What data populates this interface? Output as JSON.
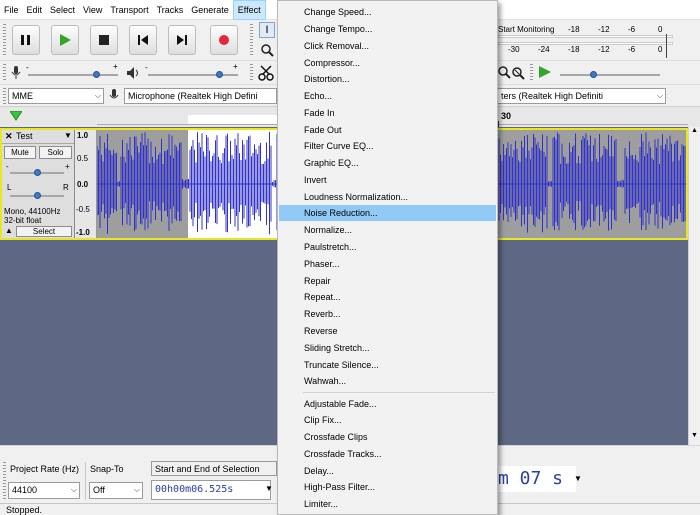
{
  "menubar": {
    "items": [
      "File",
      "Edit",
      "Select",
      "View",
      "Transport",
      "Tracks",
      "Generate",
      "Effect"
    ],
    "active_index": 7
  },
  "meter": {
    "start_monitoring": "Start Monitoring",
    "rec_ticks": [
      "-18",
      "-12",
      "-6",
      "0"
    ],
    "play_ticks": [
      "-30",
      "-24",
      "-18",
      "-12",
      "-6",
      "0"
    ]
  },
  "device": {
    "host": "MME",
    "input": "Microphone (Realtek High Defini",
    "output": "ters (Realtek High Definiti"
  },
  "timeline": {
    "tick_30": "30"
  },
  "track": {
    "name": "Test",
    "mute": "Mute",
    "solo": "Solo",
    "gain_min": "-",
    "gain_max": "+",
    "pan_left": "L",
    "pan_right": "R",
    "info_line1": "Mono, 44100Hz",
    "info_line2": "32-bit float",
    "select": "Select",
    "ruler": [
      "1.0",
      "0.5",
      "0.0",
      "-0.5",
      "-1.0"
    ]
  },
  "bottom": {
    "project_rate_label": "Project Rate (Hz)",
    "project_rate_value": "44100",
    "snap_label": "Snap-To",
    "snap_value": "Off",
    "selection_label": "Start and End of Selection",
    "selection_value": "00h00m06.525s",
    "audio_pos": "m 07 s"
  },
  "status": "Stopped.",
  "effect_menu": {
    "group1": [
      "Change Speed...",
      "Change Tempo...",
      "Click Removal...",
      "Compressor...",
      "Distortion...",
      "Echo...",
      "Fade In",
      "Fade Out",
      "Filter Curve EQ...",
      "Graphic EQ...",
      "Invert",
      "Loudness Normalization...",
      "Noise Reduction...",
      "Normalize...",
      "Paulstretch...",
      "Phaser...",
      "Repair",
      "Repeat...",
      "Reverb...",
      "Reverse",
      "Sliding Stretch...",
      "Truncate Silence...",
      "Wahwah..."
    ],
    "group2": [
      "Adjustable Fade...",
      "Clip Fix...",
      "Crossfade Clips",
      "Crossfade Tracks...",
      "Delay...",
      "High-Pass Filter...",
      "Limiter..."
    ],
    "highlighted": "Noise Reduction..."
  },
  "colors": {
    "record": "#e8253a",
    "play": "#34a32a",
    "waveform": "#3232c8",
    "track_background": "#5e6783",
    "selection": "#ffffff",
    "menu_highlight": "#91c9f7"
  }
}
